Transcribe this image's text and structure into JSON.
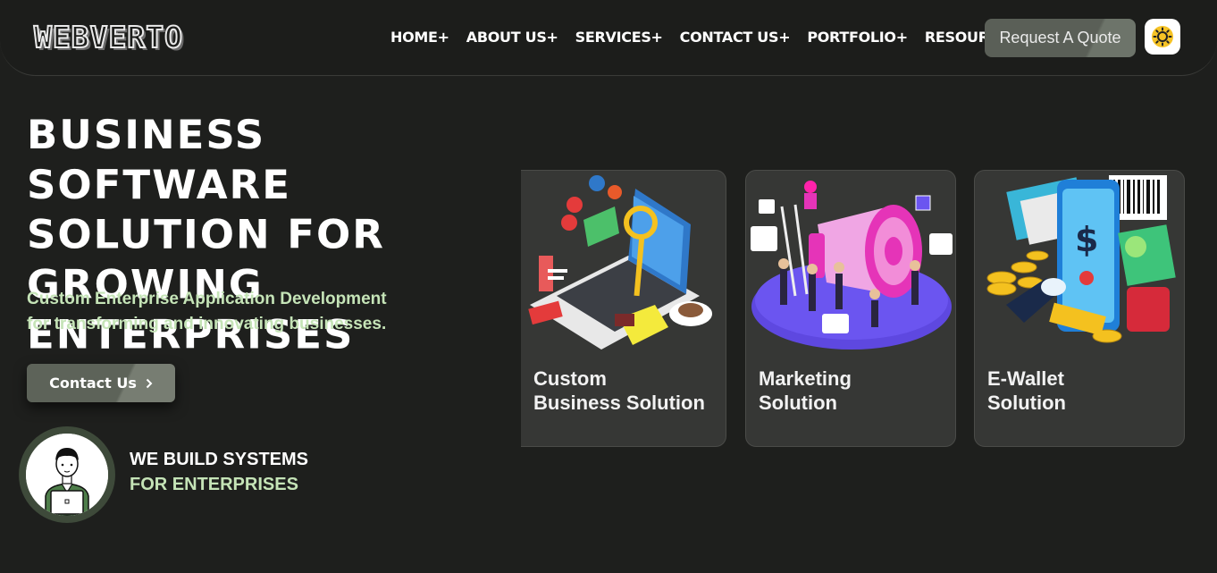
{
  "header": {
    "logo_text": "WEBVERTO",
    "nav": [
      "HOME+",
      "ABOUT US+",
      "SERVICES+",
      "CONTACT US+",
      "PORTFOLIO+",
      "RESOURCES+"
    ],
    "quote_label": "Request A Quote",
    "theme_icon": "sun-icon"
  },
  "hero": {
    "title": "BUSINESS SOFTWARE\nSOLUTION FOR\nGROWING ENTERPRISES",
    "subtitle_line1": "Custom Enterprise Application Development",
    "subtitle_line2": "for transforming and innovating businesses.",
    "contact_label": "Contact Us",
    "build_line1": "WE BUILD SYSTEMS",
    "build_line2": "FOR ENTERPRISES"
  },
  "cards": [
    {
      "title": "Custom\nBusiness Solution",
      "icon": "laptop-analytics-illustration"
    },
    {
      "title": "Marketing\nSolution",
      "icon": "megaphone-illustration"
    },
    {
      "title": "E-Wallet\nSolution",
      "icon": "mobile-wallet-illustration"
    }
  ],
  "colors": {
    "background": "#1e1f1d",
    "accent_green": "#c5e4b7",
    "button": "#5a5f57",
    "card": "#363735"
  }
}
